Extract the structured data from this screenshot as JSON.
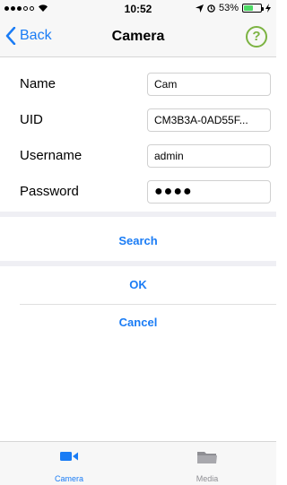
{
  "status_bar": {
    "time": "10:52",
    "battery_percent_text": "53%",
    "battery_level": 0.53
  },
  "nav": {
    "back_label": "Back",
    "title": "Camera",
    "help_label": "?"
  },
  "form": {
    "fields": [
      {
        "label": "Name",
        "value": "Cam"
      },
      {
        "label": "UID",
        "value": "CM3B3A-0AD55F..."
      },
      {
        "label": "Username",
        "value": "admin"
      },
      {
        "label": "Password",
        "value": "●●●●"
      }
    ]
  },
  "actions": {
    "search_label": "Search",
    "ok_label": "OK",
    "cancel_label": "Cancel"
  },
  "tab_bar": {
    "tabs": [
      {
        "label": "Camera",
        "icon": "video-camera-icon",
        "active": true
      },
      {
        "label": "Media",
        "icon": "folder-icon",
        "active": false
      }
    ]
  },
  "colors": {
    "accent": "#1a7cf5",
    "help": "#7cb342",
    "battery": "#4cd964"
  }
}
